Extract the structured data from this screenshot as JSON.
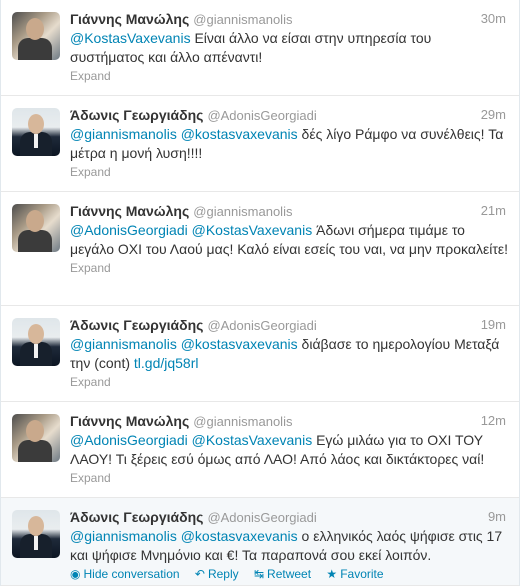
{
  "tweets": [
    {
      "fullname": "Γιάννης Μανώλης",
      "username": "@giannismanolis",
      "time": "30m",
      "mention1": "@KostasVaxevanis",
      "body": " Είναι άλλο να είσαι στην υπηρεσία του συστήματος και άλλο απέναντι!",
      "expand": "Expand"
    },
    {
      "fullname": "Άδωνις Γεωργιάδης",
      "username": "@AdonisGeorgiadi",
      "time": "29m",
      "mention1": "@giannismanolis",
      "mention2": "@kostasvaxevanis",
      "body": " δές λίγο Ράμφο να συνέλθεις! Τα μέτρα η μονή λυση!!!!",
      "expand": "Expand"
    },
    {
      "fullname": "Γιάννης Μανώλης",
      "username": "@giannismanolis",
      "time": "21m",
      "mention1": "@AdonisGeorgiadi",
      "mention2": "@KostasVaxevanis",
      "body": " Άδωνι σήμερα τιμάμε το μεγάλο ΟΧΙ του Λαού μας! Καλό είναι εσείς του ναι, να μην προκαλείτε!",
      "expand": "Expand"
    },
    {
      "fullname": "Άδωνις Γεωργιάδης",
      "username": "@AdonisGeorgiadi",
      "time": "19m",
      "mention1": "@giannismanolis",
      "mention2": "@kostasvaxevanis",
      "body": " διάβασε το ημερολογίου Μεταξά την (cont) ",
      "link": "tl.gd/jq58rl",
      "expand": "Expand"
    },
    {
      "fullname": "Γιάννης Μανώλης",
      "username": "@giannismanolis",
      "time": "12m",
      "mention1": "@AdonisGeorgiadi",
      "mention2": "@KostasVaxevanis",
      "body": " Εγώ μιλάω για το ΟΧΙ ΤΟΥ ΛΑΟΥ! Τι ξέρεις εσύ όμως από ΛΑΟ! Από λάος και δικτάκτορες ναί!",
      "expand": "Expand"
    },
    {
      "fullname": "Άδωνις Γεωργιάδης",
      "username": "@AdonisGeorgiadi",
      "time": "9m",
      "mention1": "@giannismanolis",
      "mention2": "@kostasvaxevanis",
      "body": " ο ελληνικός λαός ψήφισε στις 17 και ψήφισε Μνημόνιο και €! Τα παραπονά σου εκεί λοιπόν.",
      "actions": {
        "hide": "Hide conversation",
        "reply": "Reply",
        "retweet": "Retweet",
        "favorite": "Favorite"
      }
    }
  ],
  "icons": {
    "hide": "conversation-icon",
    "reply": "reply-icon",
    "retweet": "retweet-icon",
    "favorite": "star-icon"
  },
  "colors": {
    "link": "#0084b4",
    "meta": "#999999",
    "text": "#333333",
    "divider": "#e8e8e8",
    "highlight": "#f5f8fa"
  }
}
